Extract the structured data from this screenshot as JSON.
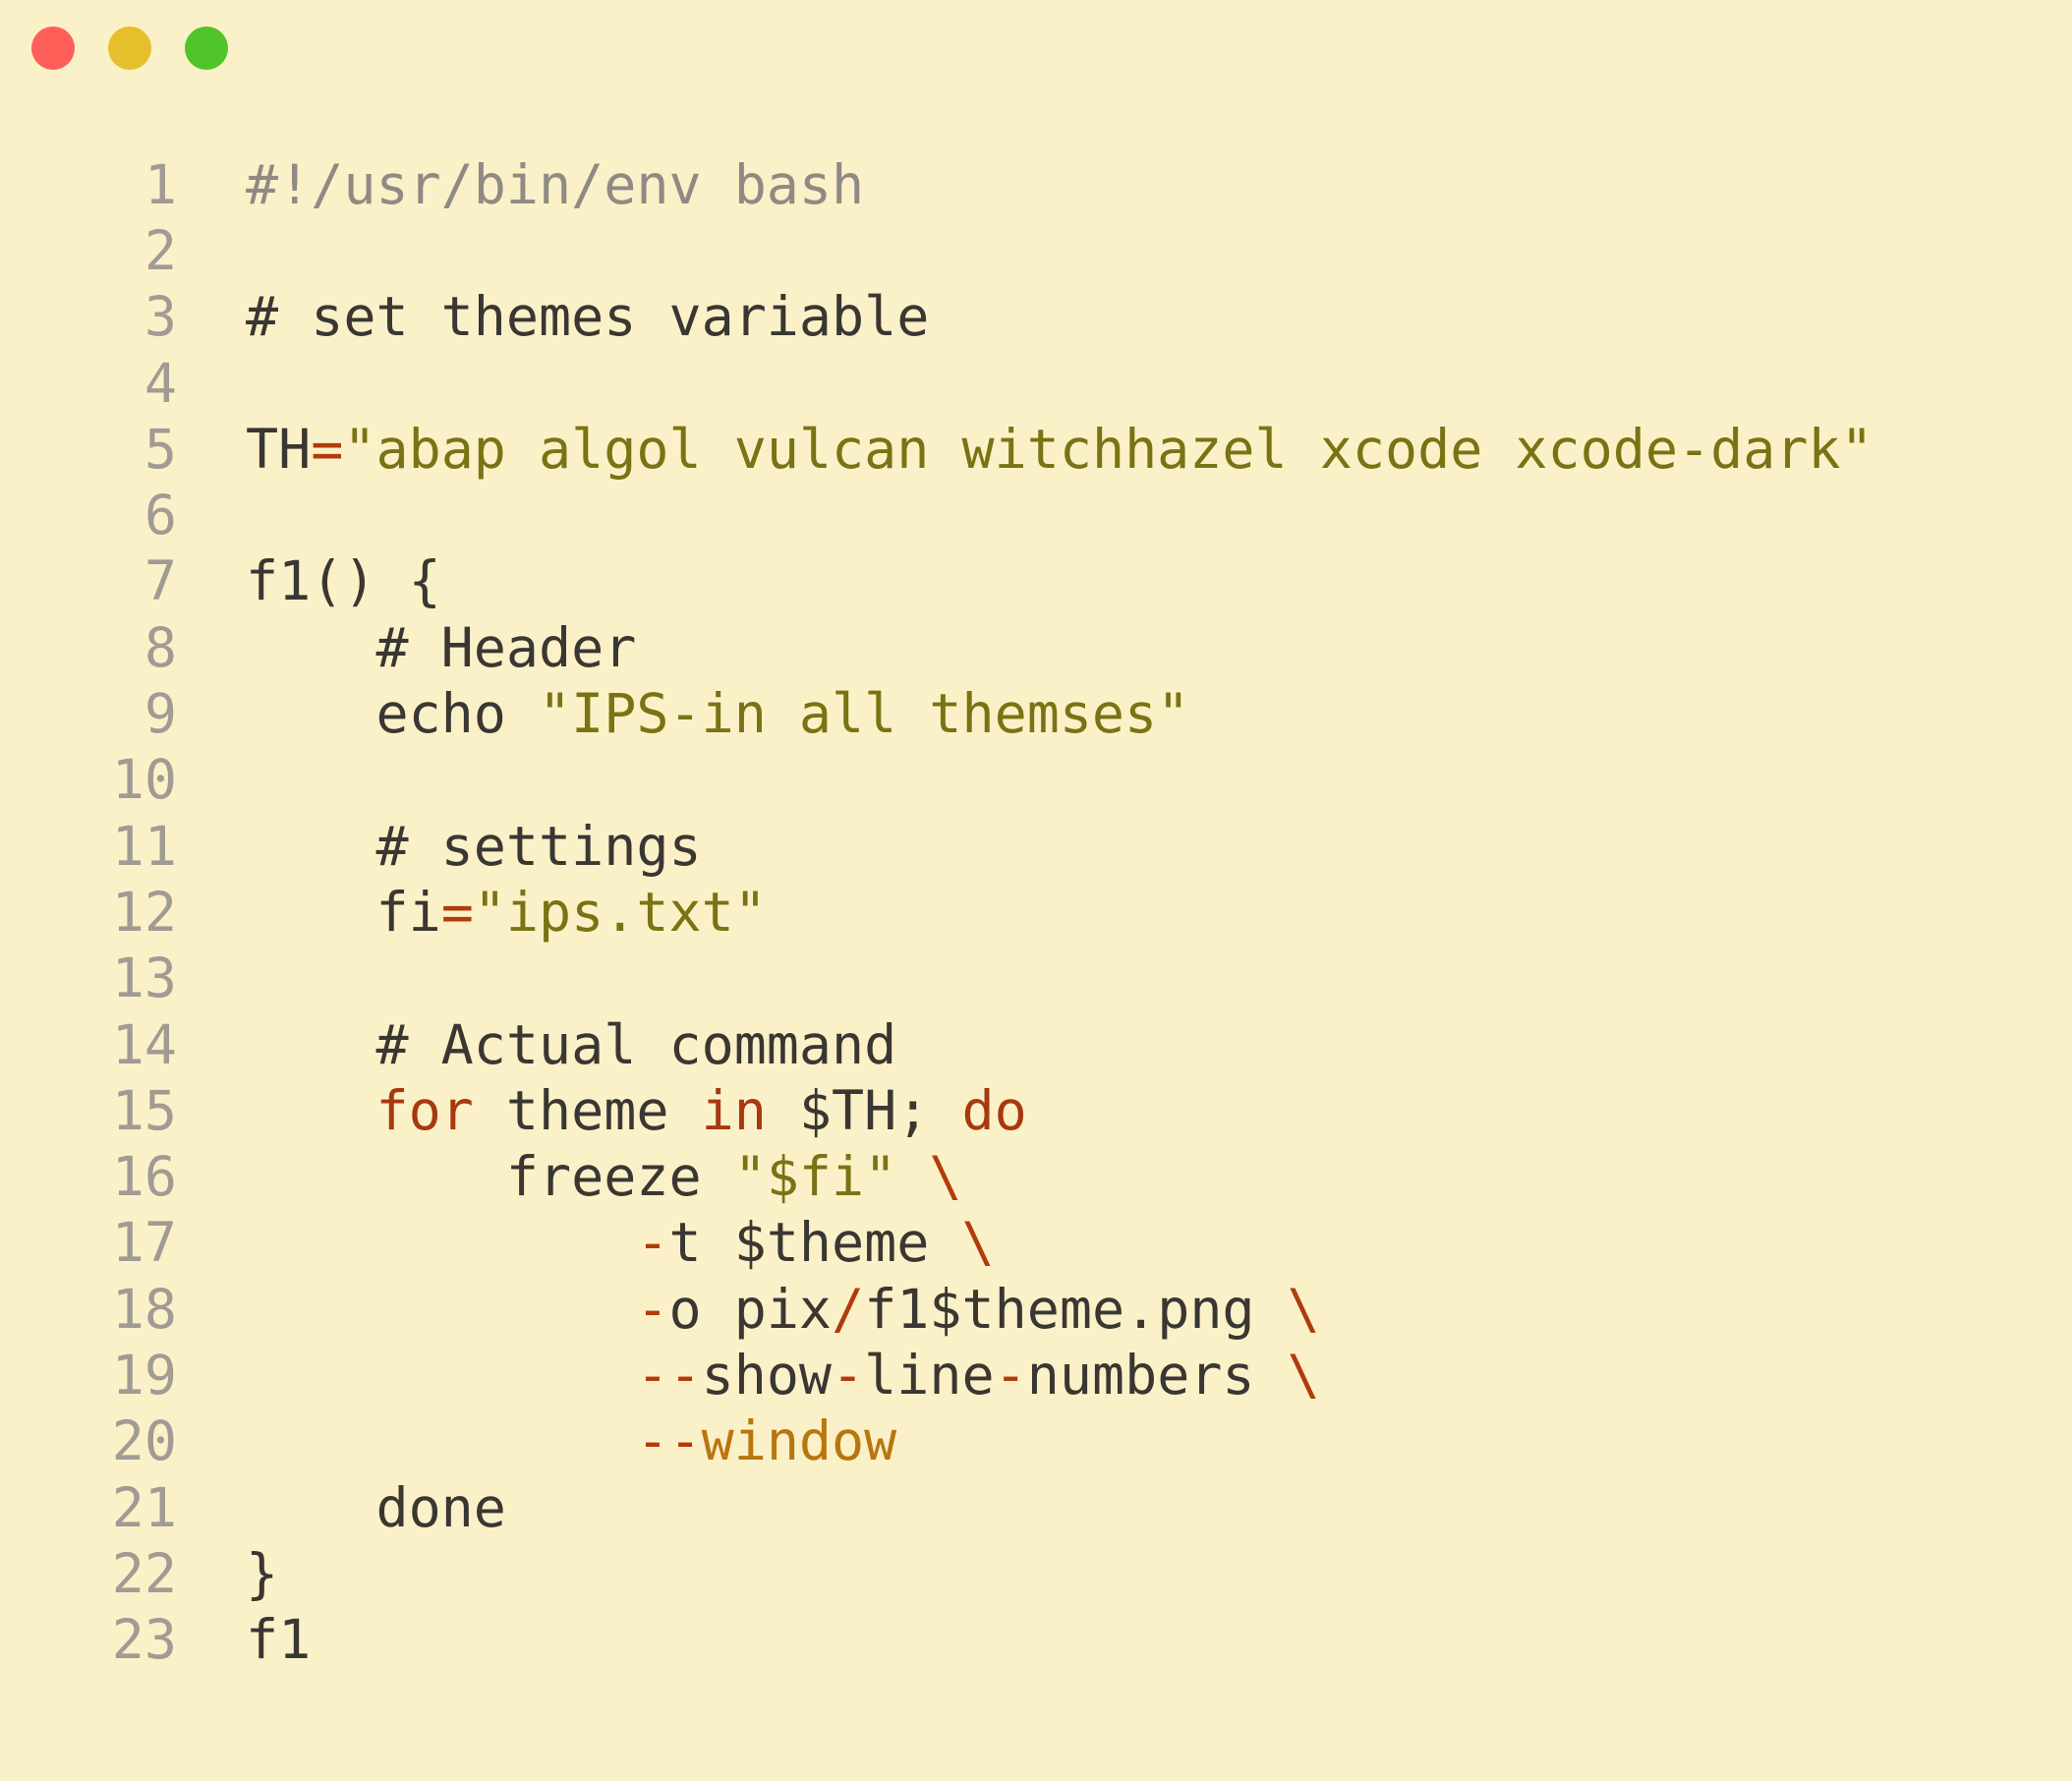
{
  "window": {
    "controls": [
      {
        "name": "close",
        "color": "#fe5f58"
      },
      {
        "name": "minimize",
        "color": "#e5bf2c"
      },
      {
        "name": "zoom",
        "color": "#4fc42b"
      }
    ]
  },
  "editor": {
    "lines": [
      {
        "n": "1",
        "tokens": [
          {
            "t": "#!/usr/bin/env bash",
            "c": "shebang"
          }
        ]
      },
      {
        "n": "2",
        "tokens": []
      },
      {
        "n": "3",
        "tokens": [
          {
            "t": "# set themes variable",
            "c": "plain"
          }
        ]
      },
      {
        "n": "4",
        "tokens": []
      },
      {
        "n": "5",
        "tokens": [
          {
            "t": "TH",
            "c": "plain"
          },
          {
            "t": "=",
            "c": "op"
          },
          {
            "t": "\"abap algol vulcan witchhazel xcode xcode-dark\"",
            "c": "str"
          }
        ]
      },
      {
        "n": "6",
        "tokens": []
      },
      {
        "n": "7",
        "tokens": [
          {
            "t": "f1() {",
            "c": "plain"
          }
        ]
      },
      {
        "n": "8",
        "tokens": [
          {
            "t": "    # Header",
            "c": "plain"
          }
        ]
      },
      {
        "n": "9",
        "tokens": [
          {
            "t": "    echo ",
            "c": "plain"
          },
          {
            "t": "\"IPS-in all themses\"",
            "c": "str"
          }
        ]
      },
      {
        "n": "10",
        "tokens": []
      },
      {
        "n": "11",
        "tokens": [
          {
            "t": "    # settings",
            "c": "plain"
          }
        ]
      },
      {
        "n": "12",
        "tokens": [
          {
            "t": "    fi",
            "c": "plain"
          },
          {
            "t": "=",
            "c": "op"
          },
          {
            "t": "\"ips.txt\"",
            "c": "str"
          }
        ]
      },
      {
        "n": "13",
        "tokens": []
      },
      {
        "n": "14",
        "tokens": [
          {
            "t": "    # Actual command",
            "c": "plain"
          }
        ]
      },
      {
        "n": "15",
        "tokens": [
          {
            "t": "    ",
            "c": "plain"
          },
          {
            "t": "for",
            "c": "kw"
          },
          {
            "t": " theme ",
            "c": "plain"
          },
          {
            "t": "in",
            "c": "kw"
          },
          {
            "t": " $TH; ",
            "c": "plain"
          },
          {
            "t": "do",
            "c": "kw"
          }
        ]
      },
      {
        "n": "16",
        "tokens": [
          {
            "t": "        freeze ",
            "c": "plain"
          },
          {
            "t": "\"$fi\"",
            "c": "str"
          },
          {
            "t": " ",
            "c": "plain"
          },
          {
            "t": "\\",
            "c": "op"
          }
        ]
      },
      {
        "n": "17",
        "tokens": [
          {
            "t": "            ",
            "c": "plain"
          },
          {
            "t": "-",
            "c": "op"
          },
          {
            "t": "t $theme ",
            "c": "plain"
          },
          {
            "t": "\\",
            "c": "op"
          }
        ]
      },
      {
        "n": "18",
        "tokens": [
          {
            "t": "            ",
            "c": "plain"
          },
          {
            "t": "-",
            "c": "op"
          },
          {
            "t": "o pix",
            "c": "plain"
          },
          {
            "t": "/",
            "c": "op"
          },
          {
            "t": "f1$theme.png ",
            "c": "plain"
          },
          {
            "t": "\\",
            "c": "op"
          }
        ]
      },
      {
        "n": "19",
        "tokens": [
          {
            "t": "            ",
            "c": "plain"
          },
          {
            "t": "--",
            "c": "op"
          },
          {
            "t": "show",
            "c": "plain"
          },
          {
            "t": "-",
            "c": "op"
          },
          {
            "t": "line",
            "c": "plain"
          },
          {
            "t": "-",
            "c": "op"
          },
          {
            "t": "numbers ",
            "c": "plain"
          },
          {
            "t": "\\",
            "c": "op"
          }
        ]
      },
      {
        "n": "20",
        "tokens": [
          {
            "t": "            ",
            "c": "plain"
          },
          {
            "t": "--",
            "c": "op"
          },
          {
            "t": "window",
            "c": "flag"
          }
        ]
      },
      {
        "n": "21",
        "tokens": [
          {
            "t": "    done",
            "c": "plain"
          }
        ]
      },
      {
        "n": "22",
        "tokens": [
          {
            "t": "}",
            "c": "plain"
          }
        ]
      },
      {
        "n": "23",
        "tokens": [
          {
            "t": "f1",
            "c": "plain"
          }
        ]
      }
    ]
  }
}
